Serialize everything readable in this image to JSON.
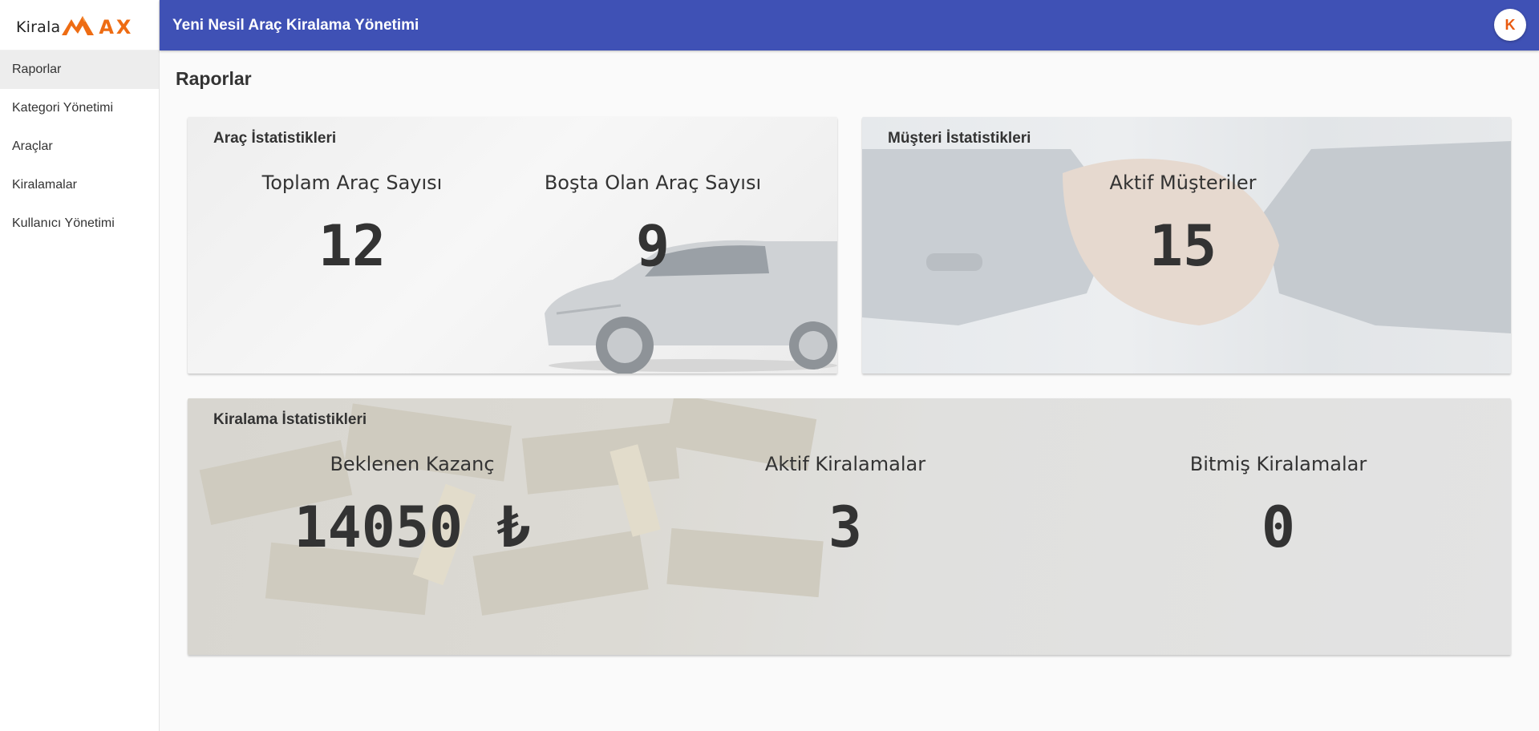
{
  "sidebar": {
    "logo": {
      "kirala": "Kirala",
      "max": "AX"
    },
    "items": [
      {
        "label": "Raporlar",
        "active": true
      },
      {
        "label": "Kategori Yönetimi",
        "active": false
      },
      {
        "label": "Araçlar",
        "active": false
      },
      {
        "label": "Kiralamalar",
        "active": false
      },
      {
        "label": "Kullanıcı Yönetimi",
        "active": false
      }
    ]
  },
  "header": {
    "title": "Yeni Nesil Araç Kiralama Yönetimi",
    "avatar_initial": "K",
    "color": "#3f51b5",
    "avatar_color": "#e95a10"
  },
  "main": {
    "page_title": "Raporlar",
    "vehicle_stats": {
      "title": "Araç İstatistikleri",
      "total_label": "Toplam Araç Sayısı",
      "total_value": "12",
      "idle_label": "Boşta Olan Araç Sayısı",
      "idle_value": "9"
    },
    "customer_stats": {
      "title": "Müşteri İstatistikleri",
      "active_label": "Aktif Müşteriler",
      "active_value": "15"
    },
    "rental_stats": {
      "title": "Kiralama İstatistikleri",
      "expected_label": "Beklenen Kazanç",
      "expected_value": "14050 ₺",
      "active_label": "Aktif Kiralamalar",
      "active_value": "3",
      "finished_label": "Bitmiş Kiralamalar",
      "finished_value": "0"
    }
  }
}
